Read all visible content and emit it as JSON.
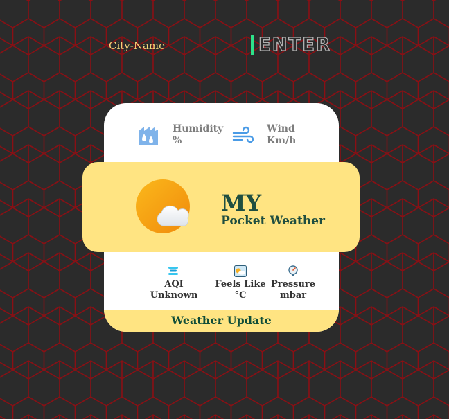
{
  "search": {
    "placeholder": "City-Name",
    "button_label": "ENTER"
  },
  "card": {
    "humidity": {
      "label": "Humidity",
      "unit": "%",
      "icon": "humidity-icon"
    },
    "wind": {
      "label": "Wind",
      "unit": "Km/h",
      "icon": "wind-icon"
    },
    "banner": {
      "title": "MY",
      "subtitle": "Pocket Weather",
      "icon": "sun-cloud-icon"
    },
    "aqi": {
      "label": "AQI",
      "value": "Unknown",
      "icon": "aqi-icon"
    },
    "feels_like": {
      "label": "Feels Like",
      "unit": "°C",
      "icon": "feels-like-icon"
    },
    "pressure": {
      "label": "Pressure",
      "unit": "mbar",
      "icon": "pressure-gauge-icon"
    },
    "footer": "Weather Update"
  },
  "colors": {
    "background": "#2b2b2b",
    "hex_lines": "#8a0f14",
    "banner_yellow": "#ffe482",
    "enter_accent": "#2ee28a",
    "title_green": "#1f4e40"
  }
}
